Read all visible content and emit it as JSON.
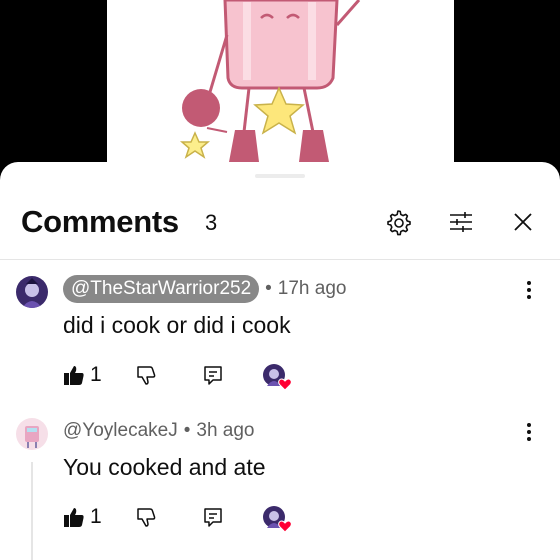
{
  "comments_panel": {
    "title": "Comments",
    "count": "3"
  },
  "comments": [
    {
      "author": "@TheStarWarrior252",
      "separator": "•",
      "time": "17h ago",
      "text": "did i cook or did i cook",
      "likes": "1",
      "creator_hearted": true
    },
    {
      "author": "@YoylecakeJ",
      "separator": "•",
      "time": "3h ago",
      "text": "You cooked and ate",
      "likes": "1",
      "creator_hearted": true
    }
  ],
  "icons": {
    "settings": "gear-icon",
    "filter": "sliders-icon",
    "close": "close-icon",
    "more": "kebab-icon",
    "like": "thumbs-up-icon",
    "dislike": "thumbs-down-icon",
    "reply": "reply-icon",
    "creator_heart": "heart-icon"
  },
  "colors": {
    "author_chip_bg": "#888888",
    "heart": "#ff0033",
    "character_pink": "#f7c3cf"
  }
}
